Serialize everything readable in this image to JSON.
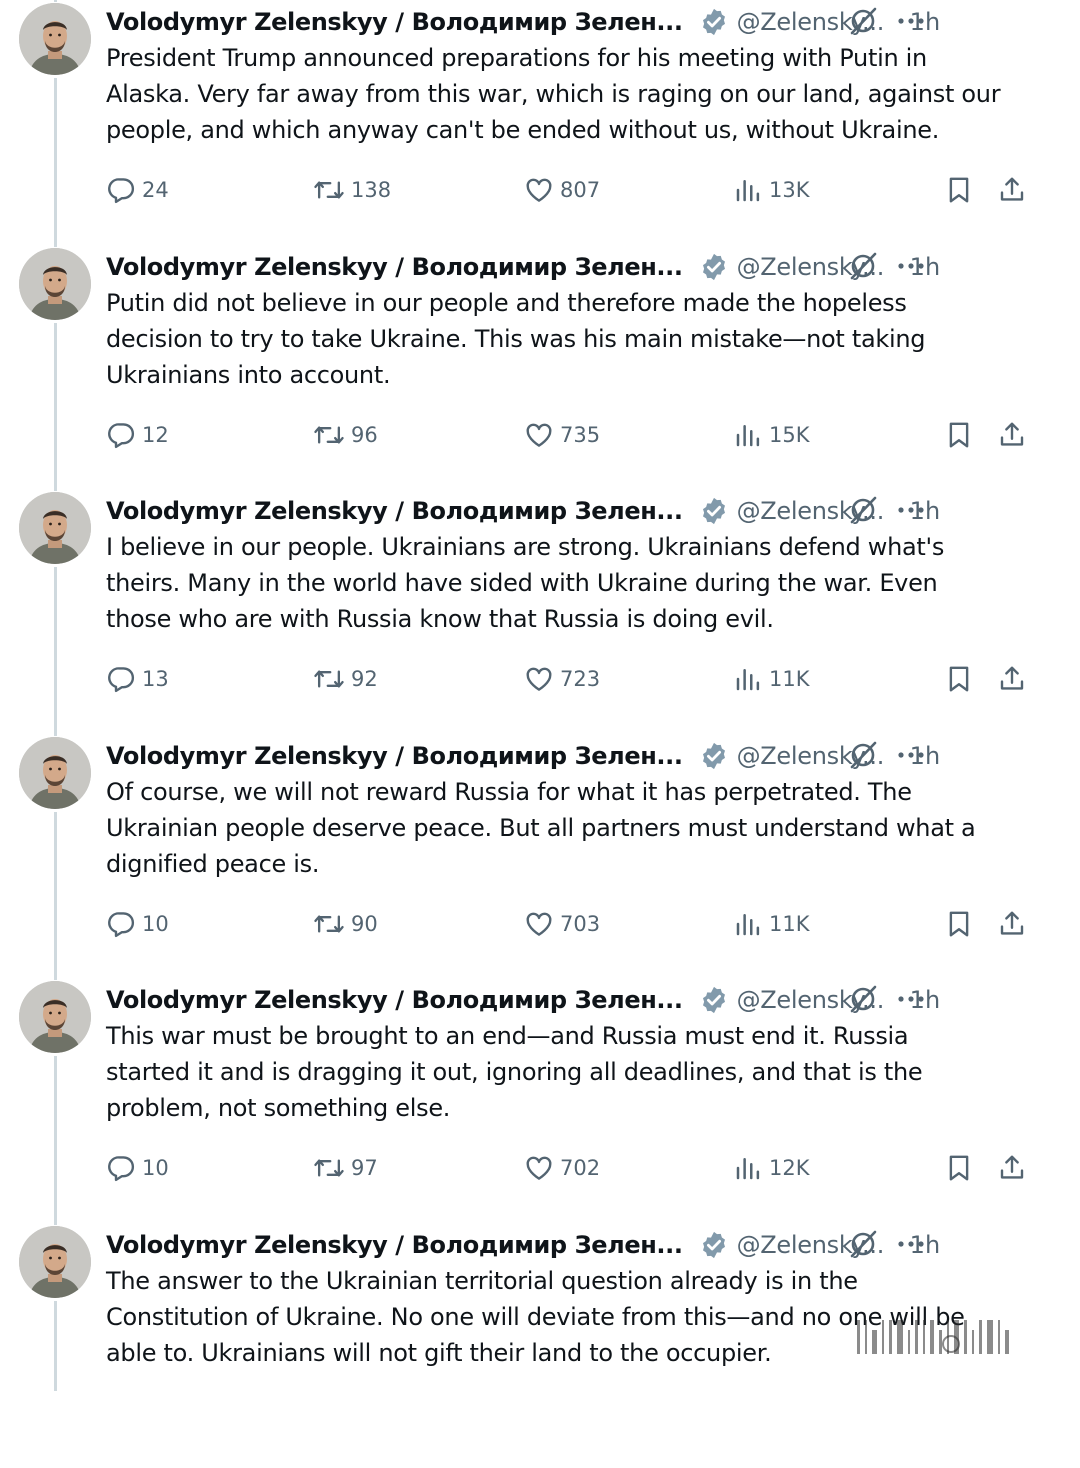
{
  "author": {
    "name": "Volodymyr Zelenskyy / Володимир Зелен...",
    "handle": "@Zelensky...",
    "separator": "·",
    "time": "1h"
  },
  "colors": {
    "text_primary": "#0f1419",
    "text_secondary": "#536471",
    "verified_badge": "#829aab",
    "thread_line": "#cfd9de"
  },
  "icons": {
    "verified": "verified-badge-icon",
    "grok": "grok-icon",
    "more": "more-icon",
    "reply": "reply-icon",
    "retweet": "retweet-icon",
    "like": "like-icon",
    "views": "views-icon",
    "bookmark": "bookmark-icon",
    "share": "share-icon"
  },
  "tweets": [
    {
      "lines": [
        "President Trump announced preparations for his meeting with Putin in",
        "Alaska. Very far away from this war, which is raging on our land, against our",
        "people, and which anyway can't be ended without us, without Ukraine."
      ],
      "replies": "24",
      "retweets": "138",
      "likes": "807",
      "views": "13K"
    },
    {
      "lines": [
        "Putin did not believe in our people and therefore made the hopeless",
        "decision to try to take Ukraine. This was his main mistake—not taking",
        "Ukrainians into account."
      ],
      "replies": "12",
      "retweets": "96",
      "likes": "735",
      "views": "15K"
    },
    {
      "lines": [
        "I believe in our people. Ukrainians are strong. Ukrainians defend what's",
        "theirs. Many in the world have sided with Ukraine during the war. Even",
        "those who are with Russia know that Russia is doing evil."
      ],
      "replies": "13",
      "retweets": "92",
      "likes": "723",
      "views": "11K"
    },
    {
      "lines": [
        "Of course, we will not reward Russia for what it has perpetrated. The",
        "Ukrainian people deserve peace. But all partners must understand what a",
        "dignified peace is."
      ],
      "replies": "10",
      "retweets": "90",
      "likes": "703",
      "views": "11K"
    },
    {
      "lines": [
        "This war must be brought to an end—and Russia must end it. Russia",
        "started it and is dragging it out, ignoring all deadlines, and that is the",
        "problem, not something else."
      ],
      "replies": "10",
      "retweets": "97",
      "likes": "702",
      "views": "12K"
    },
    {
      "lines": [
        "The answer to the Ukrainian territorial question already is in the",
        "Constitution of Ukraine. No one will deviate from this—and no one will be",
        "able to. Ukrainians will not gift their land to the occupier."
      ]
    }
  ]
}
